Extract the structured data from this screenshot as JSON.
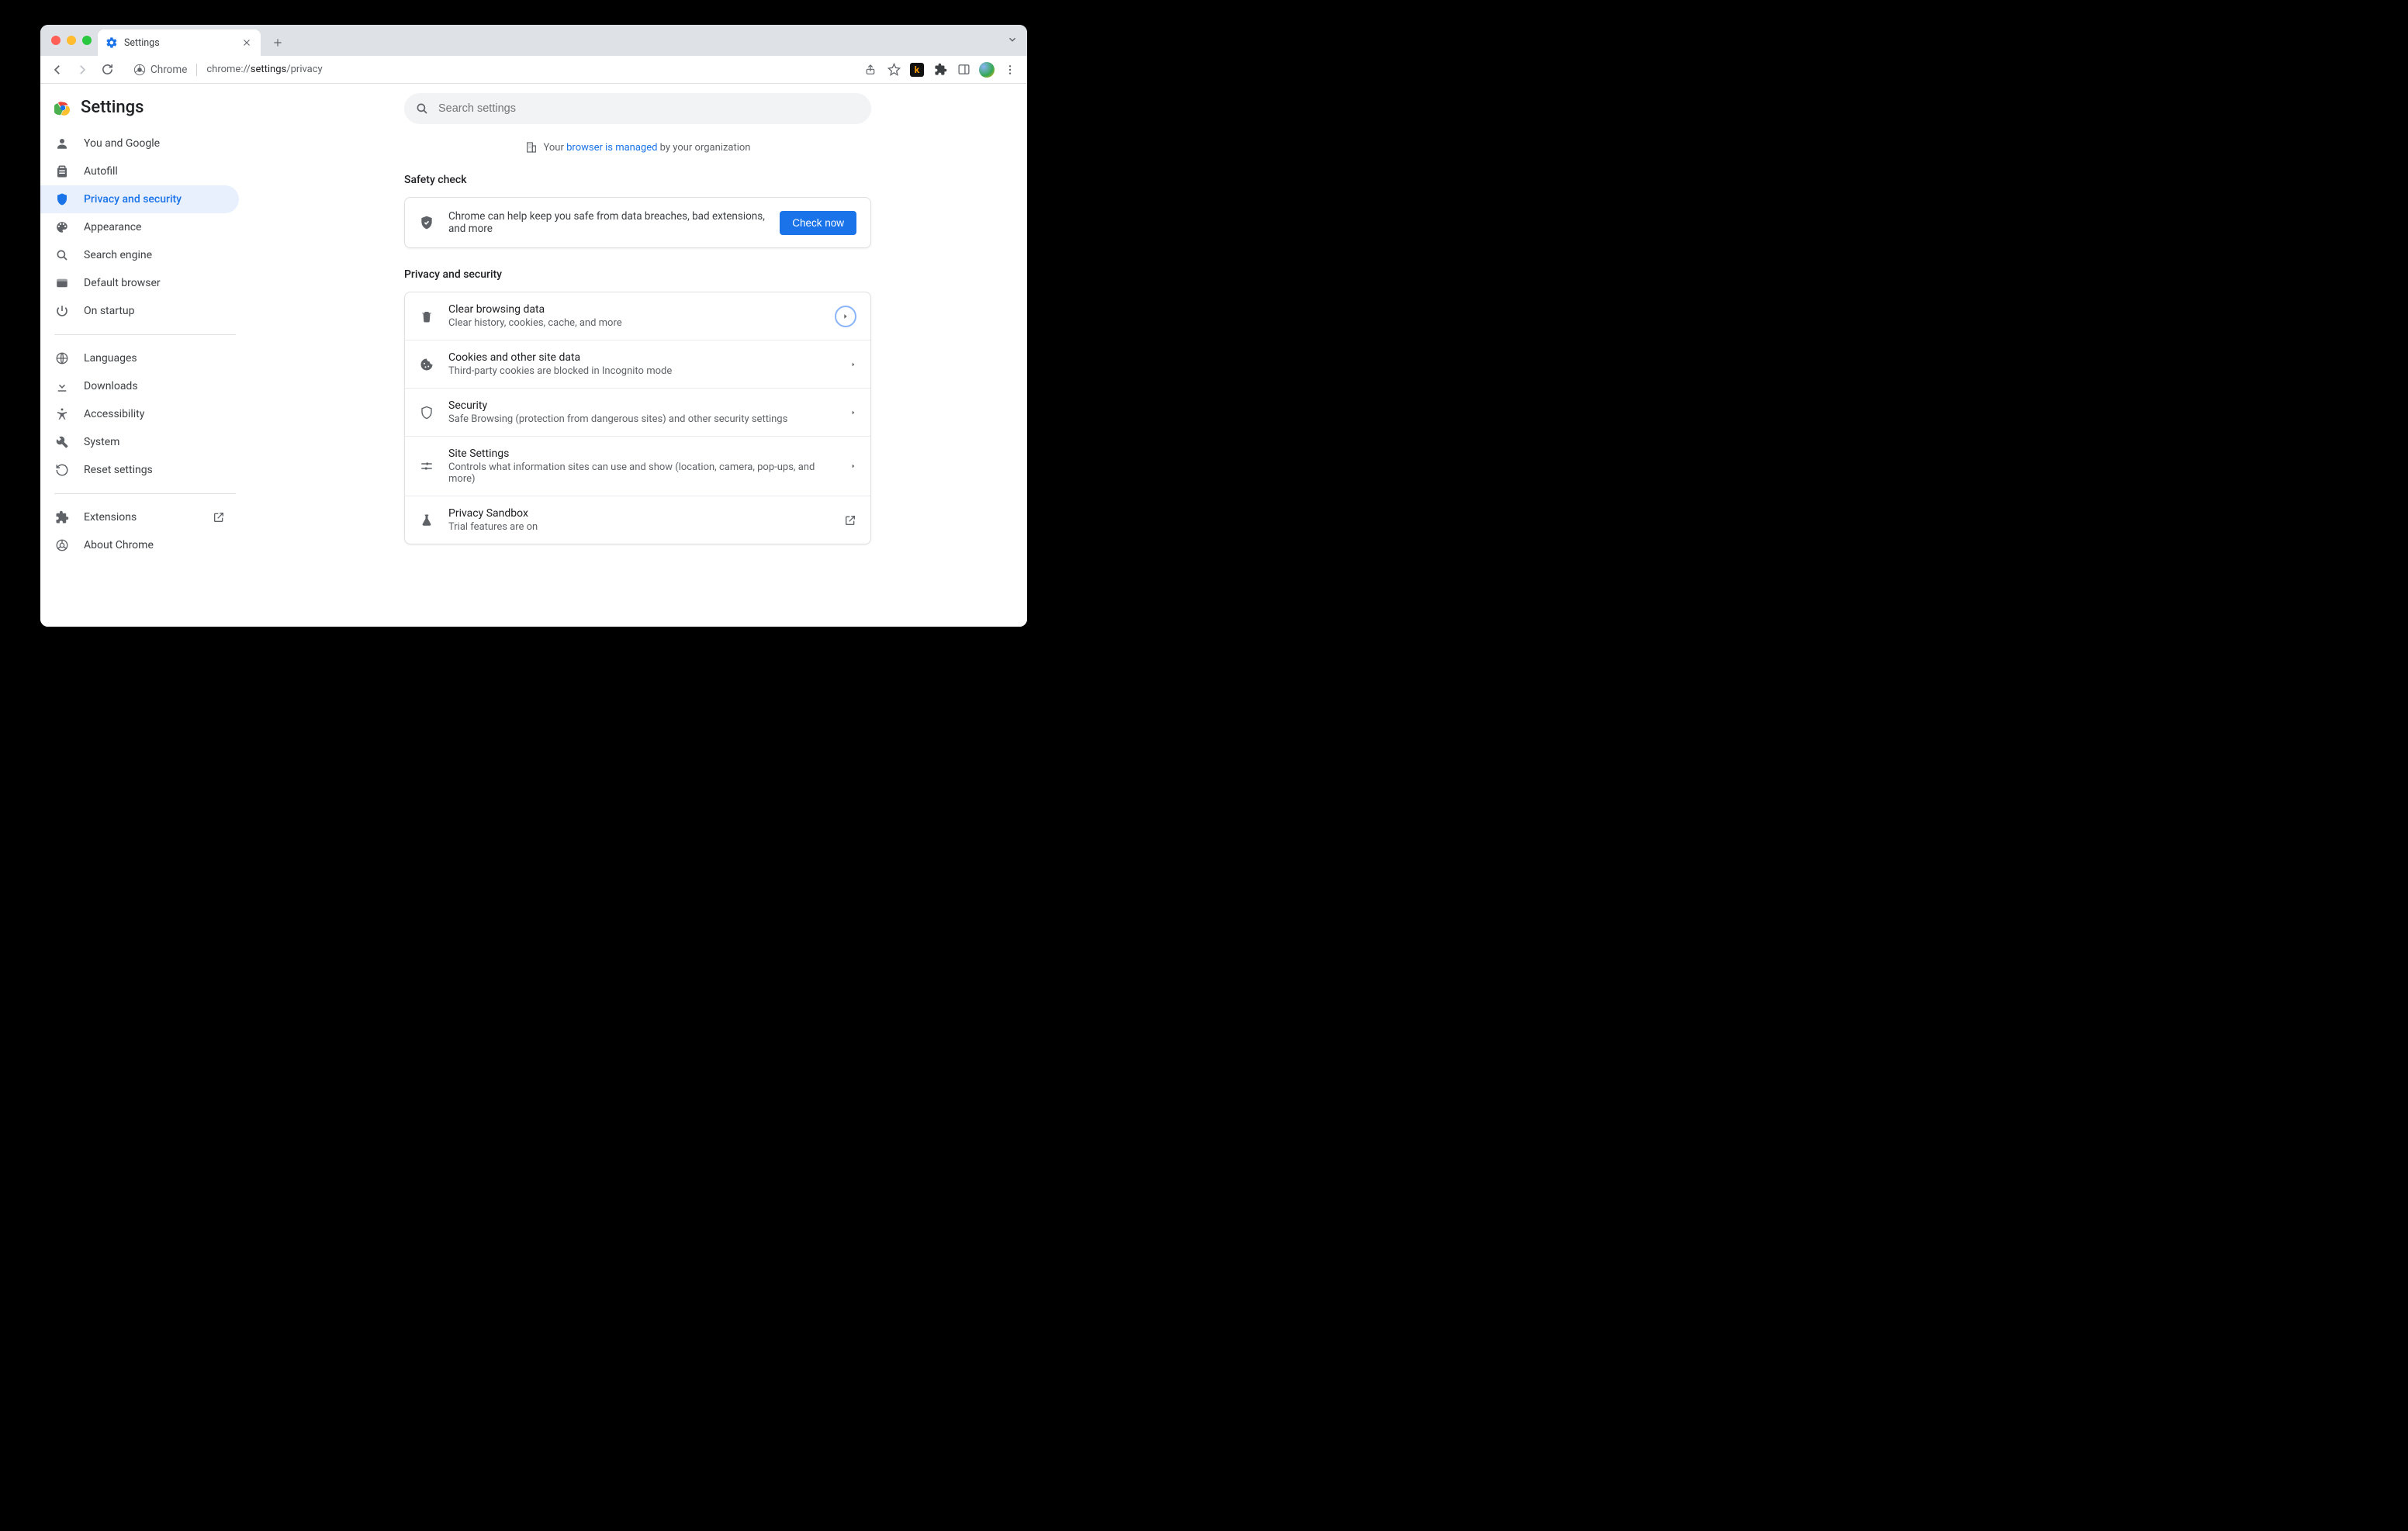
{
  "window": {
    "tab_title": "Settings"
  },
  "toolbar": {
    "chip_label": "Chrome",
    "url_prefix": "chrome://",
    "url_mid": "settings",
    "url_suffix": "/privacy"
  },
  "brand": {
    "title": "Settings"
  },
  "sidebar": {
    "items": [
      {
        "label": "You and Google"
      },
      {
        "label": "Autofill"
      },
      {
        "label": "Privacy and security"
      },
      {
        "label": "Appearance"
      },
      {
        "label": "Search engine"
      },
      {
        "label": "Default browser"
      },
      {
        "label": "On startup"
      }
    ],
    "advanced": [
      {
        "label": "Languages"
      },
      {
        "label": "Downloads"
      },
      {
        "label": "Accessibility"
      },
      {
        "label": "System"
      },
      {
        "label": "Reset settings"
      }
    ],
    "footer": [
      {
        "label": "Extensions"
      },
      {
        "label": "About Chrome"
      }
    ]
  },
  "search": {
    "placeholder": "Search settings"
  },
  "managed": {
    "prefix": "Your ",
    "link": "browser is managed",
    "suffix": " by your organization"
  },
  "safety": {
    "title": "Safety check",
    "text": "Chrome can help keep you safe from data breaches, bad extensions, and more",
    "button": "Check now"
  },
  "privacy": {
    "title": "Privacy and security",
    "rows": [
      {
        "title": "Clear browsing data",
        "sub": "Clear history, cookies, cache, and more"
      },
      {
        "title": "Cookies and other site data",
        "sub": "Third-party cookies are blocked in Incognito mode"
      },
      {
        "title": "Security",
        "sub": "Safe Browsing (protection from dangerous sites) and other security settings"
      },
      {
        "title": "Site Settings",
        "sub": "Controls what information sites can use and show (location, camera, pop-ups, and more)"
      },
      {
        "title": "Privacy Sandbox",
        "sub": "Trial features are on"
      }
    ]
  }
}
